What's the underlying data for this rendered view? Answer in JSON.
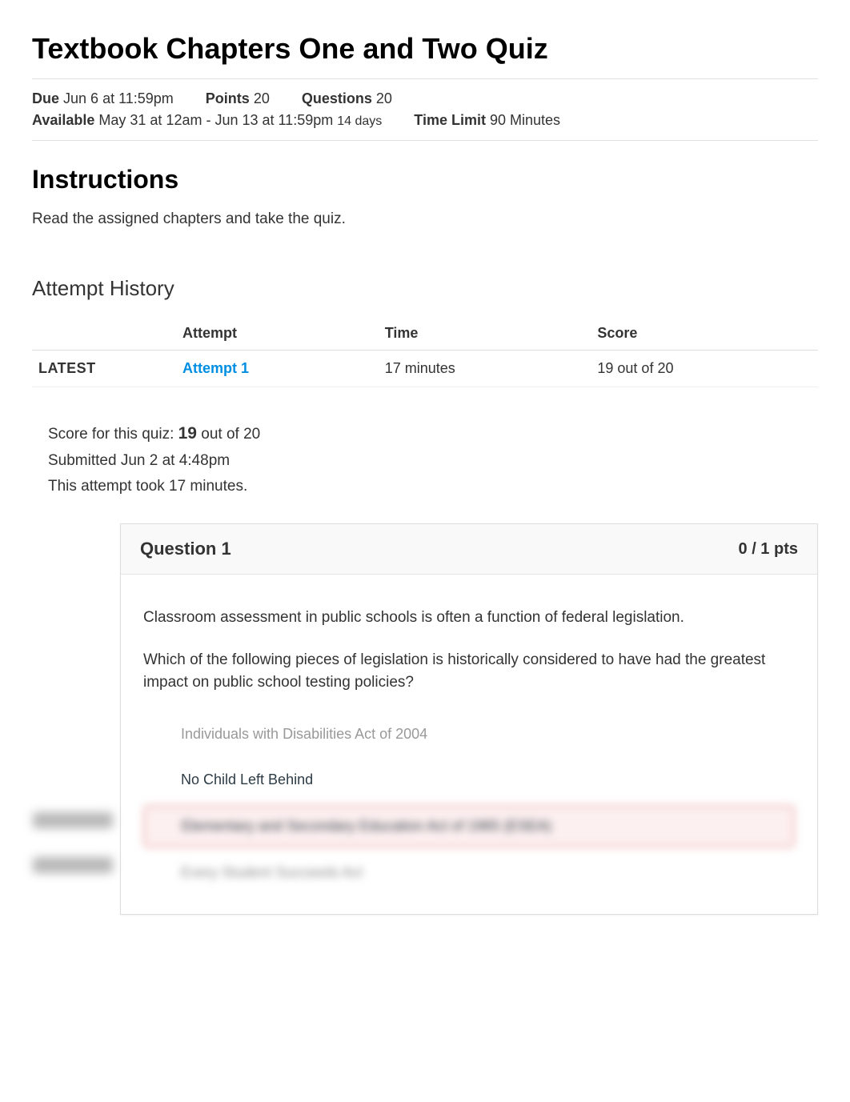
{
  "title": "Textbook Chapters One and Two Quiz",
  "meta": {
    "due_label": "Due",
    "due_value": "Jun 6 at 11:59pm",
    "points_label": "Points",
    "points_value": "20",
    "questions_label": "Questions",
    "questions_value": "20",
    "available_label": "Available",
    "available_value": "May 31 at 12am - Jun 13 at 11:59pm",
    "available_days": "14 days",
    "timelimit_label": "Time Limit",
    "timelimit_value": "90 Minutes"
  },
  "instructions": {
    "heading": "Instructions",
    "body": "Read the assigned chapters and take the quiz."
  },
  "attempt_history": {
    "heading": "Attempt History",
    "headers": {
      "col1": "",
      "col2": "Attempt",
      "col3": "Time",
      "col4": "Score"
    },
    "rows": [
      {
        "tag": "LATEST",
        "attempt": "Attempt 1",
        "time": "17 minutes",
        "score": "19 out of 20"
      }
    ]
  },
  "summary": {
    "line1_pre": "Score for this quiz: ",
    "line1_score": "19",
    "line1_post": " out of 20",
    "line2": "Submitted Jun 2 at 4:48pm",
    "line3": "This attempt took 17 minutes."
  },
  "question": {
    "label": "Question 1",
    "pts": "0 / 1 pts",
    "text1": "Classroom assessment in public schools is often a function of federal legislation.",
    "text2": "Which of the following pieces of legislation is historically considered to have had the greatest impact on public school testing policies?",
    "answers": [
      {
        "text": "Individuals with Disabilities Act of 2004",
        "style": "faded"
      },
      {
        "text": "No Child Left Behind",
        "style": "normal"
      },
      {
        "text": "Elementary and Secondary Education Act of 1965 (ESEA)",
        "style": "highlighted"
      },
      {
        "text": "Every Student Succeeds Act",
        "style": "blurred"
      }
    ]
  }
}
